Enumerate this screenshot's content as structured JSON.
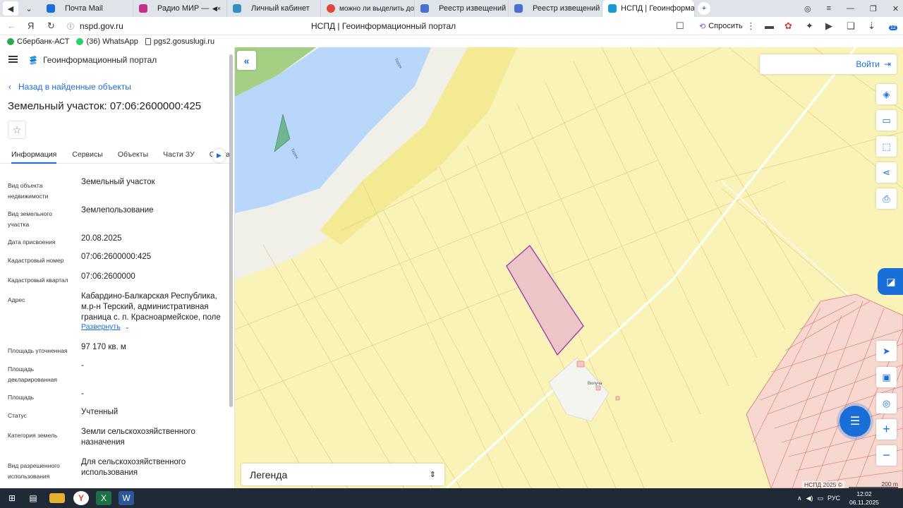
{
  "browser": {
    "tabs": [
      {
        "label": "Почта Mail",
        "color": "#1a6ed8"
      },
      {
        "label": "Радио МИР — слушать",
        "color": "#c42f8a"
      },
      {
        "label": "Личный кабинет",
        "color": "#2f8ec4"
      },
      {
        "label": "можно ли выделить доле",
        "color": "#e0463a"
      },
      {
        "label": "Реестр извещений",
        "color": "#4a6fd0"
      },
      {
        "label": "Реестр извещений",
        "color": "#4a6fd0"
      },
      {
        "label": "НСПД | Геоинформаци",
        "color": "#1a9ad8"
      }
    ],
    "url": "nspd.gov.ru",
    "page_title": "НСПД | Геоинформационный портал",
    "ask_label": "Спросить",
    "extension_badge": "12",
    "bookmarks": [
      {
        "label": "Сбербанк-АСТ",
        "color": "#2ea84a"
      },
      {
        "label": "(36) WhatsApp",
        "color": "#25d366"
      },
      {
        "label": "pgs2.gosuslugi.ru",
        "color": "#555555"
      }
    ]
  },
  "panel": {
    "portal_name": "Геоинформационный портал",
    "back_label": "Назад в найденные объекты",
    "title": "Земельный участок: 07:06:2600000:425",
    "tabs": [
      "Информация",
      "Сервисы",
      "Объекты",
      "Части ЗУ",
      "Соста"
    ],
    "expand_label": "Развернуть",
    "fields": [
      {
        "label": "Вид объекта недвижимости",
        "value": "Земельный участок"
      },
      {
        "label": "Вид земельного участка",
        "value": "Землепользование"
      },
      {
        "label": "Дата присвоения",
        "value": "20.08.2025"
      },
      {
        "label": "Кадастровый номер",
        "value": "07:06:2600000:425"
      },
      {
        "label": "Кадастровый квартал",
        "value": "07:06:2600000"
      },
      {
        "label": "Адрес",
        "value": "Кабардино-Балкарская Республика, м.р-н Терский, административная граница с. п. Красноармейское, поле"
      },
      {
        "label": "Площадь уточненная",
        "value": "97 170 кв. м"
      },
      {
        "label": "Площадь декларированная",
        "value": "-"
      },
      {
        "label": "Площадь",
        "value": "-"
      },
      {
        "label": "Статус",
        "value": "Учтенный"
      },
      {
        "label": "Категория земель",
        "value": "Земли сельскохозяйственного назначения"
      },
      {
        "label": "Вид разрешенного использования",
        "value": "Для сельскохозяйственного использования"
      }
    ]
  },
  "map": {
    "login_label": "Войти",
    "legend_label": "Легенда",
    "copyright": "НСПД 2025 ©",
    "scale_label": "200 m",
    "river_labels": [
      "Терек",
      "Терек"
    ],
    "settlement_label": "Вилуча",
    "colors": {
      "base": "#faf3b8",
      "river": "#b9d7fb",
      "forest": "#a5cf82",
      "highlight_fill": "#ecc6c6",
      "highlight_stroke": "#a23ab0",
      "urban_stroke": "#e0716b",
      "accent": "#1a6ed8"
    }
  },
  "taskbar": {
    "lang": "РУС",
    "time": "12:02",
    "date": "06.11.2025"
  }
}
